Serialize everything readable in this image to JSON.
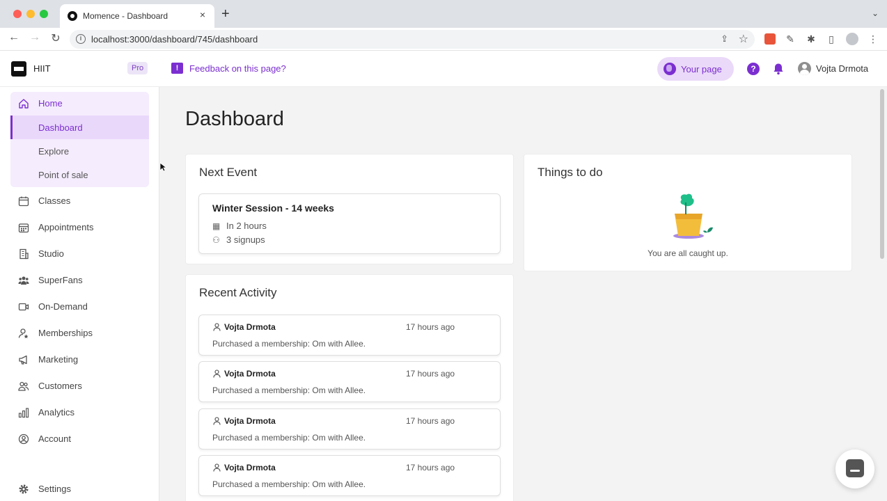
{
  "browser": {
    "tab_title": "Momence - Dashboard",
    "tab_close": "×",
    "new_tab": "+",
    "tab_menu": "⌄",
    "url": "localhost:3000/dashboard/745/dashboard",
    "back": "←",
    "forward": "→",
    "reload": "↻"
  },
  "header": {
    "brand": "HIIT",
    "plan_badge": "Pro",
    "feedback": "Feedback on this page?",
    "your_page": "Your page",
    "user_name": "Vojta Drmota"
  },
  "sidebar": {
    "home": "Home",
    "home_children": [
      "Dashboard",
      "Explore",
      "Point of sale"
    ],
    "items": [
      {
        "label": "Classes",
        "icon": "calendar-icon"
      },
      {
        "label": "Appointments",
        "icon": "appointments-icon"
      },
      {
        "label": "Studio",
        "icon": "building-icon"
      },
      {
        "label": "SuperFans",
        "icon": "superfans-icon"
      },
      {
        "label": "On-Demand",
        "icon": "video-icon"
      },
      {
        "label": "Memberships",
        "icon": "membership-icon"
      },
      {
        "label": "Marketing",
        "icon": "megaphone-icon"
      },
      {
        "label": "Customers",
        "icon": "customers-icon"
      },
      {
        "label": "Analytics",
        "icon": "analytics-icon"
      },
      {
        "label": "Account",
        "icon": "account-icon"
      }
    ],
    "settings": "Settings"
  },
  "main": {
    "title": "Dashboard",
    "next_event": {
      "heading": "Next Event",
      "name": "Winter Session - 14 weeks",
      "when": "In 2 hours",
      "signups": "3 signups"
    },
    "todo": {
      "heading": "Things to do",
      "empty": "You are all caught up."
    },
    "recent_activity": {
      "heading": "Recent Activity",
      "items": [
        {
          "name": "Vojta Drmota",
          "time": "17 hours ago",
          "desc": "Purchased a membership: Om with Allee."
        },
        {
          "name": "Vojta Drmota",
          "time": "17 hours ago",
          "desc": "Purchased a membership: Om with Allee."
        },
        {
          "name": "Vojta Drmota",
          "time": "17 hours ago",
          "desc": "Purchased a membership: Om with Allee."
        },
        {
          "name": "Vojta Drmota",
          "time": "17 hours ago",
          "desc": "Purchased a membership: Om with Allee."
        }
      ]
    }
  },
  "colors": {
    "accent": "#7b2fd0",
    "accent_bg": "#f5ecfd"
  }
}
